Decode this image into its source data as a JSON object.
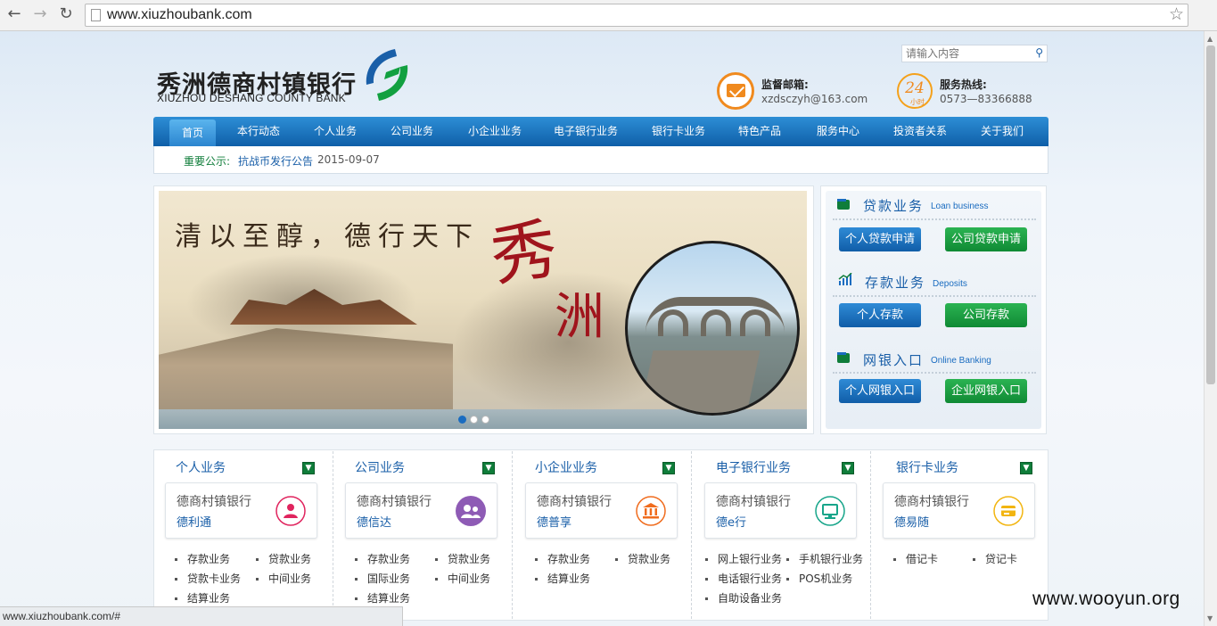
{
  "browser": {
    "url": "www.xiuzhoubank.com"
  },
  "header": {
    "logo_cn": "秀洲德商村镇银行",
    "logo_en": "XIUZHOU DESHANG COUNTY BANK",
    "search_placeholder": "请输入内容",
    "mail_label": "监督邮箱:",
    "mail_value": "xzdsczyh@163.com",
    "hotline_label": "服务热线:",
    "hotline_value": "0573—83366888",
    "hotline_badge": "24",
    "hotline_badge_sub": "小时"
  },
  "nav": {
    "items": [
      "首页",
      "本行动态",
      "个人业务",
      "公司业务",
      "小企业业务",
      "电子银行业务",
      "银行卡业务",
      "特色产品",
      "服务中心",
      "投资者关系",
      "关于我们"
    ]
  },
  "notice": {
    "label": "重要公示:",
    "title": "抗战币发行公告",
    "date": "2015-09-07"
  },
  "banner": {
    "slogan": "清以至醇，德行天下",
    "big1": "秀",
    "big2": "洲",
    "slide_count": 3,
    "active_slide": 1
  },
  "services": {
    "loan": {
      "title": "贷款业务",
      "title_en": "Loan business",
      "btn1": "个人贷款申请",
      "btn2": "公司贷款申请"
    },
    "deposit": {
      "title": "存款业务",
      "title_en": "Deposits",
      "btn1": "个人存款",
      "btn2": "公司存款"
    },
    "online": {
      "title": "网银入口",
      "title_en": "Online Banking",
      "btn1": "个人网银入口",
      "btn2": "企业网银入口"
    }
  },
  "columns": [
    {
      "title": "个人业务",
      "card_l1": "德商村镇银行",
      "card_l2": "德利通",
      "icon": "person-icon",
      "icon_color": "#e0245e",
      "links": [
        "存款业务",
        "贷款业务",
        "贷款卡业务",
        "中间业务",
        "结算业务"
      ]
    },
    {
      "title": "公司业务",
      "card_l1": "德商村镇银行",
      "card_l2": "德信达",
      "icon": "group-icon",
      "icon_color": "#8e5bb5",
      "links": [
        "存款业务",
        "贷款业务",
        "国际业务",
        "中间业务",
        "结算业务"
      ]
    },
    {
      "title": "小企业业务",
      "card_l1": "德商村镇银行",
      "card_l2": "德普享",
      "icon": "bank-building-icon",
      "icon_color": "#f06c1e",
      "links": [
        "存款业务",
        "贷款业务",
        "结算业务"
      ]
    },
    {
      "title": "电子银行业务",
      "card_l1": "德商村镇银行",
      "card_l2": "德e行",
      "icon": "computer-icon",
      "icon_color": "#17a58a",
      "links": [
        "网上银行业务",
        "手机银行业务",
        "电话银行业务",
        "POS机业务",
        "自助设备业务"
      ]
    },
    {
      "title": "银行卡业务",
      "card_l1": "德商村镇银行",
      "card_l2": "德易随",
      "icon": "card-icon",
      "icon_color": "#f2b510",
      "links": [
        "借记卡",
        "贷记卡"
      ]
    }
  ],
  "status_url": "www.xiuzhoubank.com/#",
  "watermark": "www.wooyun.org",
  "colors": {
    "nav_blue": "#1a6cc0",
    "green": "#0f8a34",
    "accent_orange": "#f08a1e"
  }
}
